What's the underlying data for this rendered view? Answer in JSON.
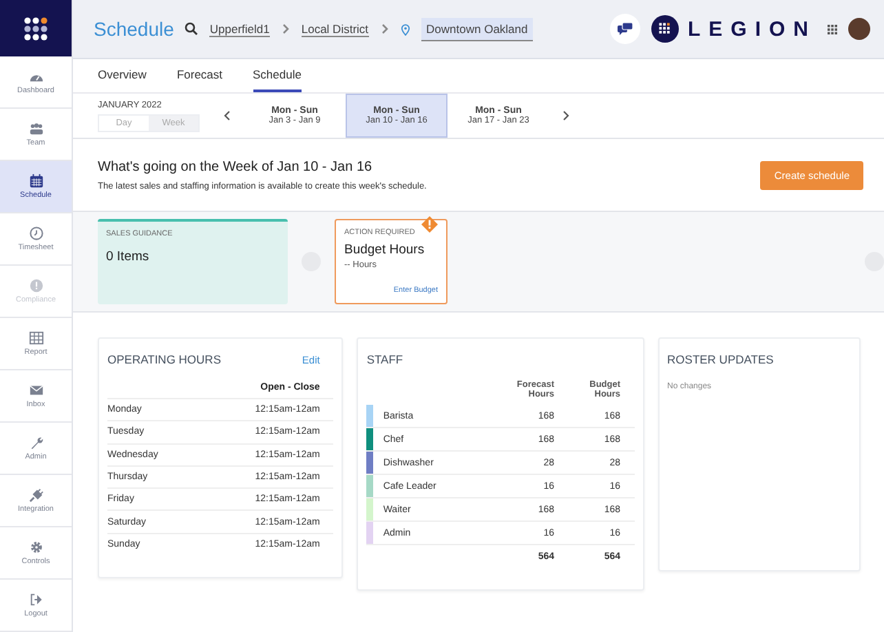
{
  "sidebar": {
    "items": [
      {
        "label": "Dashboard",
        "selected": false,
        "disabled": false
      },
      {
        "label": "Team",
        "selected": false,
        "disabled": false
      },
      {
        "label": "Schedule",
        "selected": true,
        "disabled": false
      },
      {
        "label": "Timesheet",
        "selected": false,
        "disabled": false
      },
      {
        "label": "Compliance",
        "selected": false,
        "disabled": true
      },
      {
        "label": "Report",
        "selected": false,
        "disabled": false
      },
      {
        "label": "Inbox",
        "selected": false,
        "disabled": false
      },
      {
        "label": "Admin",
        "selected": false,
        "disabled": false
      },
      {
        "label": "Integration",
        "selected": false,
        "disabled": false
      },
      {
        "label": "Controls",
        "selected": false,
        "disabled": false
      },
      {
        "label": "Logout",
        "selected": false,
        "disabled": false
      }
    ]
  },
  "header": {
    "title": "Schedule",
    "breadcrumbs": [
      {
        "label": "Upperfield1",
        "selected": false
      },
      {
        "label": "Local District",
        "selected": false
      },
      {
        "label": "Downtown Oakland",
        "selected": true
      }
    ],
    "brand": "LEGION"
  },
  "tabs": [
    {
      "label": "Overview",
      "selected": false
    },
    {
      "label": "Forecast",
      "selected": false
    },
    {
      "label": "Schedule",
      "selected": true
    }
  ],
  "date_nav": {
    "month": "JANUARY 2022",
    "view_toggle": [
      {
        "label": "Day",
        "selected": false
      },
      {
        "label": "Week",
        "selected": true
      }
    ],
    "weeks": [
      {
        "range": "Mon - Sun",
        "dates": "Jan 3 - Jan 9",
        "selected": false
      },
      {
        "range": "Mon - Sun",
        "dates": "Jan 10 - Jan 16",
        "selected": true
      },
      {
        "range": "Mon - Sun",
        "dates": "Jan 17 - Jan 23",
        "selected": false
      }
    ]
  },
  "summary": {
    "heading": "What's going on the Week of Jan 10 - Jan 16",
    "description": "The latest sales and staffing information is available to create this week's schedule.",
    "button": "Create schedule"
  },
  "cards": [
    {
      "kind": "guidance",
      "label": "SALES GUIDANCE",
      "title": "0 Items"
    },
    {
      "kind": "action",
      "label": "ACTION REQUIRED",
      "title": "Budget Hours",
      "subtitle": "-- Hours",
      "link": "Enter Budget"
    }
  ],
  "operating_hours": {
    "title": "OPERATING HOURS",
    "edit": "Edit",
    "column": "Open - Close",
    "rows": [
      {
        "day": "Monday",
        "hours": "12:15am-12am"
      },
      {
        "day": "Tuesday",
        "hours": "12:15am-12am"
      },
      {
        "day": "Wednesday",
        "hours": "12:15am-12am"
      },
      {
        "day": "Thursday",
        "hours": "12:15am-12am"
      },
      {
        "day": "Friday",
        "hours": "12:15am-12am"
      },
      {
        "day": "Saturday",
        "hours": "12:15am-12am"
      },
      {
        "day": "Sunday",
        "hours": "12:15am-12am"
      }
    ]
  },
  "staff": {
    "title": "STAFF",
    "columns": [
      "Forecast Hours",
      "Budget Hours"
    ],
    "rows": [
      {
        "role": "Barista",
        "forecast": "168",
        "budget": "168",
        "color": "#a8d4f5"
      },
      {
        "role": "Chef",
        "forecast": "168",
        "budget": "168",
        "color": "#0f8f7e"
      },
      {
        "role": "Dishwasher",
        "forecast": "28",
        "budget": "28",
        "color": "#6f7ec4"
      },
      {
        "role": "Cafe Leader",
        "forecast": "16",
        "budget": "16",
        "color": "#a6d9c6"
      },
      {
        "role": "Waiter",
        "forecast": "168",
        "budget": "168",
        "color": "#d4f5cc"
      },
      {
        "role": "Admin",
        "forecast": "16",
        "budget": "16",
        "color": "#e3d3f2"
      }
    ],
    "totals": [
      "564",
      "564"
    ]
  },
  "roster_updates": {
    "title": "ROSTER UPDATES",
    "message": "No changes"
  }
}
